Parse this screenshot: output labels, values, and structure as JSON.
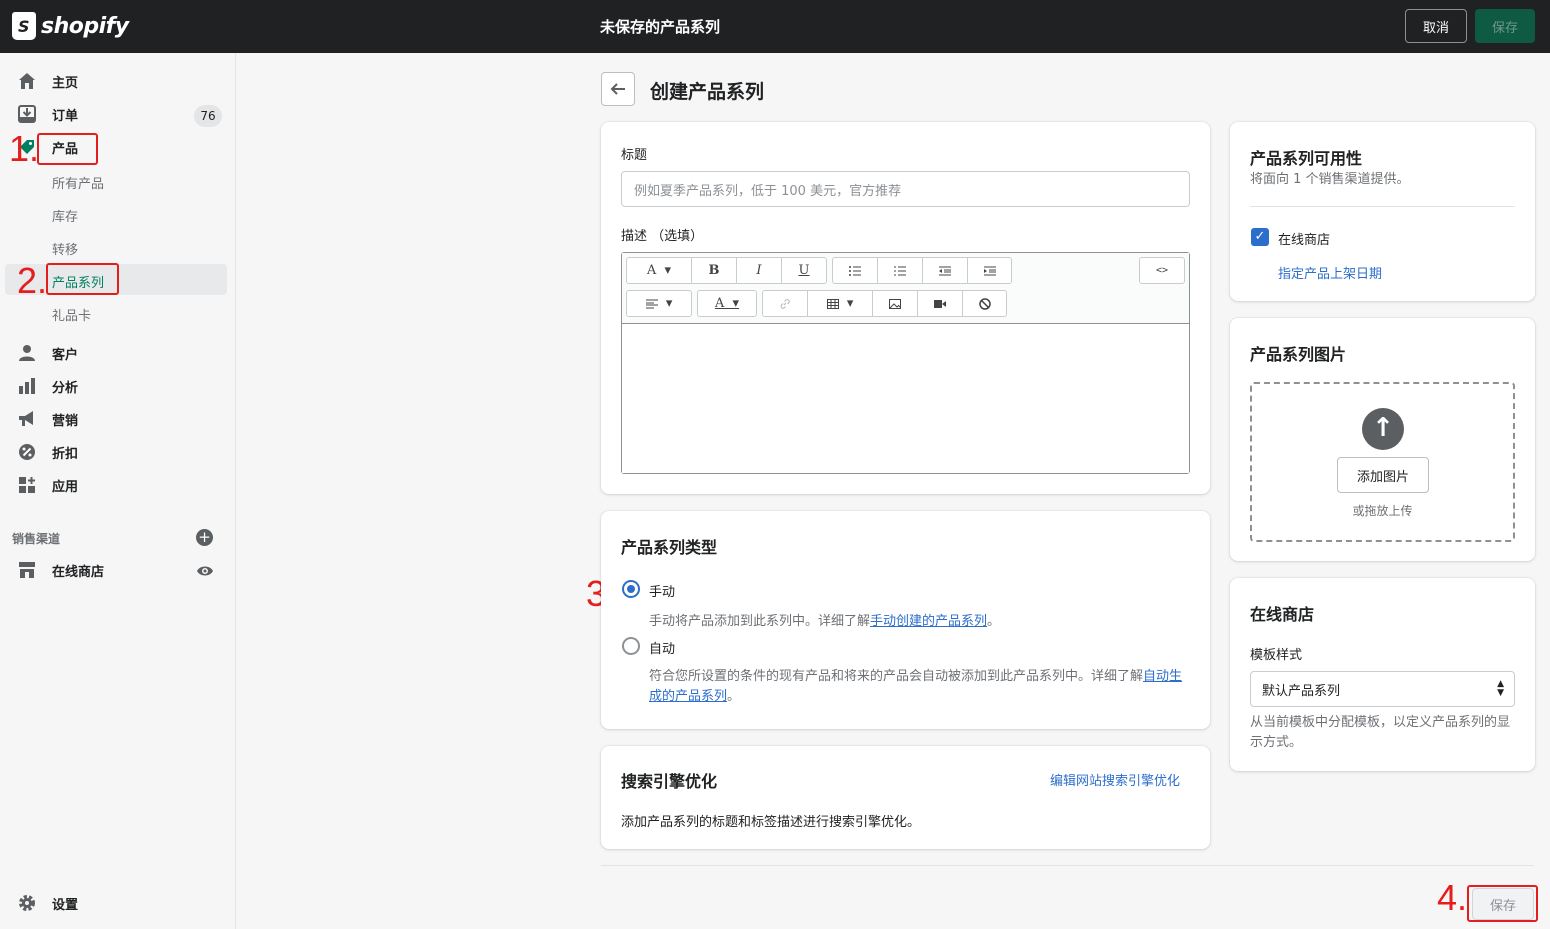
{
  "topbar": {
    "brand": "shopify",
    "title": "未保存的产品系列",
    "cancel_label": "取消",
    "save_label": "保存"
  },
  "sidebar": {
    "items": [
      {
        "label": "主页",
        "icon": "home-icon"
      },
      {
        "label": "订单",
        "icon": "orders-icon",
        "badge": "76"
      },
      {
        "label": "产品",
        "icon": "products-tag-icon"
      },
      {
        "label": "客户",
        "icon": "customers-icon"
      },
      {
        "label": "分析",
        "icon": "analytics-icon"
      },
      {
        "label": "营销",
        "icon": "marketing-icon"
      },
      {
        "label": "折扣",
        "icon": "discounts-icon"
      },
      {
        "label": "应用",
        "icon": "apps-icon"
      }
    ],
    "product_sub": [
      "所有产品",
      "库存",
      "转移",
      "产品系列",
      "礼品卡"
    ],
    "sales_channels_label": "销售渠道",
    "online_store": "在线商店",
    "settings": "设置"
  },
  "annotations": [
    "1.",
    "2.",
    "3.",
    "4."
  ],
  "page": {
    "title": "创建产品系列"
  },
  "title_card": {
    "title_label": "标题",
    "title_placeholder": "例如夏季产品系列，低于 100 美元，官方推荐",
    "desc_label": "描述 （选填）"
  },
  "type_card": {
    "heading": "产品系列类型",
    "manual_label": "手动",
    "manual_help_prefix": "手动将产品添加到此系列中。详细了解",
    "manual_help_link": "手动创建的产品系列",
    "manual_help_suffix": "。",
    "auto_label": "自动",
    "auto_help_prefix": "符合您所设置的条件的现有产品和将来的产品会自动被添加到此产品系列中。详细了解",
    "auto_help_link": "自动生成的产品系列",
    "auto_help_suffix": "。"
  },
  "seo_card": {
    "heading": "搜索引擎优化",
    "edit_link": "编辑网站搜索引擎优化",
    "help": "添加产品系列的标题和标签描述进行搜索引擎优化。"
  },
  "availability_card": {
    "heading": "产品系列可用性",
    "sub": "将面向 1 个销售渠道提供。",
    "channel": "在线商店",
    "schedule_link": "指定产品上架日期"
  },
  "image_card": {
    "heading": "产品系列图片",
    "add_button": "添加图片",
    "drop_hint": "或拖放上传"
  },
  "store_card": {
    "heading": "在线商店",
    "template_label": "模板样式",
    "template_value": "默认产品系列",
    "help": "从当前模板中分配模板，以定义产品系列的显示方式。"
  },
  "footer": {
    "save_label": "保存"
  },
  "colors": {
    "accent": "#2c6ecb",
    "topbar": "#202123",
    "primary_green": "#0f5a43",
    "annotation_red": "#e41d1d"
  }
}
